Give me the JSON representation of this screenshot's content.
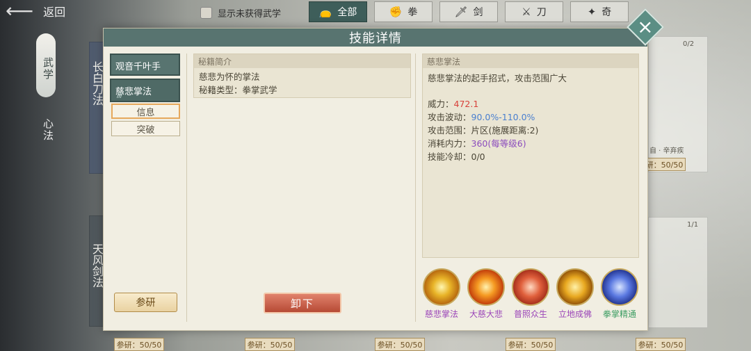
{
  "topbar": {
    "back_label": "返回",
    "show_unobtained_label": "显示未获得武学"
  },
  "filters": [
    {
      "label": "全部",
      "icon": "bag-icon",
      "active": true
    },
    {
      "label": "拳",
      "icon": "fist-icon",
      "active": false
    },
    {
      "label": "剑",
      "icon": "sword-icon",
      "active": false
    },
    {
      "label": "刀",
      "icon": "blade-icon",
      "active": false
    },
    {
      "label": "奇",
      "icon": "shuriken-icon",
      "active": false
    }
  ],
  "rail": {
    "tab_active": "武学",
    "tab_other": "心法"
  },
  "background": {
    "card_titles": [
      "长白刀法",
      "天风剑法"
    ],
    "counts": [
      "0/2",
      "1/1"
    ],
    "research_tags": [
      "参研：50/50",
      "参研：50/50",
      "参研：50/50",
      "参研：50/50",
      "参研：50/50",
      "参研：50/50",
      "参研：50/50"
    ],
    "fragment_text": "自 · 辛弃疾"
  },
  "modal": {
    "title": "技能详情",
    "tabs": [
      {
        "label": "观音千叶手",
        "active": false
      },
      {
        "label": "慈悲掌法",
        "active": true,
        "sub": "///"
      }
    ],
    "sub_buttons": [
      {
        "label": "信息",
        "active": true
      },
      {
        "label": "突破",
        "active": false
      }
    ],
    "research_button": "参研",
    "secret_book": {
      "header": "秘籍简介",
      "line1": "慈悲为怀的掌法",
      "line2": "秘籍类型：拳掌武学"
    },
    "unload_button": "卸下",
    "skill": {
      "header": "慈悲掌法",
      "description": "慈悲掌法的起手招式，攻击范围广大",
      "stats": [
        {
          "key": "威力：",
          "value": "472.1",
          "color": "#d8413a"
        },
        {
          "key": "攻击波动：",
          "value": "90.0%-110.0%",
          "color": "#4a7fcf"
        },
        {
          "key": "攻击范围：",
          "value": "片区(施展距离:2)",
          "color": "#4a4536"
        },
        {
          "key": "消耗内力：",
          "value": "360(每等级6)",
          "color": "#8b4bbd",
          "value_prefix_color": "#8b4bbd"
        },
        {
          "key": "技能冷却：",
          "value": "0/0",
          "color": "#4a4536"
        }
      ]
    },
    "moves": [
      {
        "label": "慈悲掌法",
        "color": "#9b45b8",
        "orb": "radial-gradient(circle,#fff6b0 0%,#e8b428 35%,#b86a10 70%,#5a3006 100%)"
      },
      {
        "label": "大慈大悲",
        "color": "#9b45b8",
        "orb": "radial-gradient(circle,#fff2b0 0%,#f59a22 35%,#c4400c 70%,#5a1806 100%)"
      },
      {
        "label": "普照众生",
        "color": "#9b45b8",
        "orb": "radial-gradient(circle,#ffd8c0 0%,#e0603c 40%,#a02a18 75%,#4a0e06 100%)"
      },
      {
        "label": "立地成佛",
        "color": "#9b45b8",
        "orb": "radial-gradient(circle,#fff1a8 0%,#e8a820 40%,#8a4a06 75%,#2c1602 100%)"
      },
      {
        "label": "拳掌精通",
        "color": "#3f9e64",
        "orb": "radial-gradient(circle,#d8e4ff 0%,#5a78e0 40%,#1e2f8a 75%,#0a1030 100%)"
      }
    ]
  }
}
